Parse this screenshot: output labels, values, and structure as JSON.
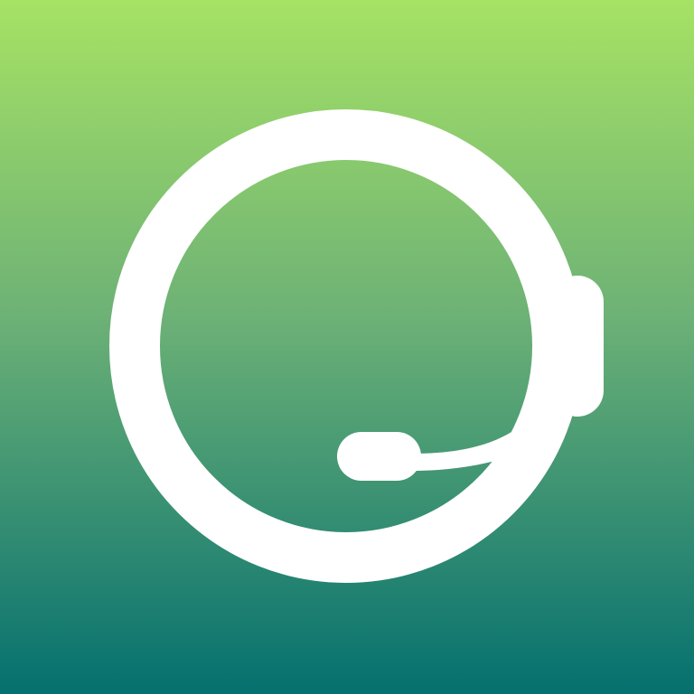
{
  "app_icon": {
    "icon_name": "headset-icon",
    "semantic": "customer-support-headset",
    "colors": {
      "gradient_top": "#a6e264",
      "gradient_mid": "#6eb276",
      "gradient_bottom": "#05706f",
      "glyph": "#ffffff"
    }
  }
}
